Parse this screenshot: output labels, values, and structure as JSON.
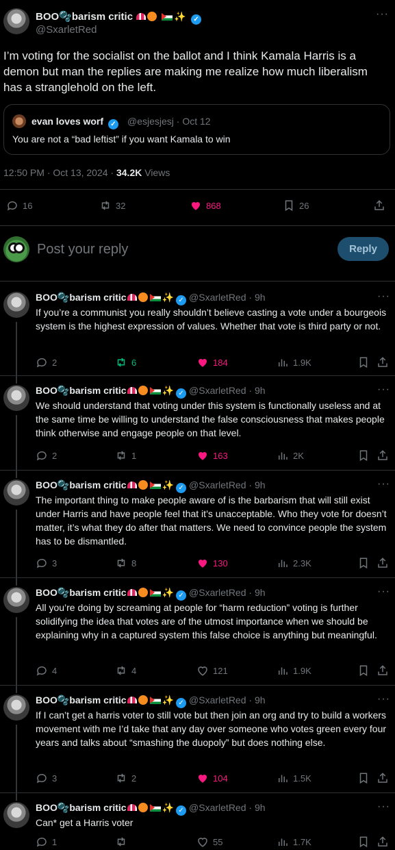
{
  "author": {
    "display_name": "BOO🫧barism critic",
    "handle": "@SxarletRed"
  },
  "main_tweet": {
    "text": "I’m voting for the socialist on the ballot and I think Kamala Harris is a demon but man the replies are making me realize how much liberalism has a stranglehold on the left.",
    "time": "12:50 PM · Oct 13, 2024 · ",
    "views": "34.2K",
    "views_label": " Views",
    "stats": {
      "replies": "16",
      "reposts": "32",
      "likes": "868",
      "bookmarks": "26"
    }
  },
  "quote": {
    "name": "evan loves worf",
    "meta": "@esjesjesj · Oct 12",
    "text": "You are not a “bad leftist” if you want Kamala to win"
  },
  "reply_box": {
    "placeholder": "Post your reply",
    "button": "Reply"
  },
  "replies": [
    {
      "age": "· 9h",
      "text": "If you’re a communist you really shouldn’t believe casting a vote under a bourgeois system is the highest expression of values. Whether that vote is third party or not.",
      "replies": "2",
      "reposts": "6",
      "likes": "184",
      "views": "1.9K"
    },
    {
      "age": "· 9h",
      "text": "We should understand that voting under this system is functionally useless and at the same time be willing to understand the false consciousness that makes people think otherwise and engage people on that level.",
      "replies": "2",
      "reposts": "1",
      "likes": "163",
      "views": "2K"
    },
    {
      "age": "· 9h",
      "text": "The important thing to make people aware of is the barbarism that will still exist under Harris and have people feel that it’s unacceptable. Who they vote for doesn’t matter, it’s what they do after that matters. We need to convince people the system has to be dismantled.",
      "replies": "3",
      "reposts": "8",
      "likes": "130",
      "views": "2.3K"
    },
    {
      "age": "· 9h",
      "text": "All you’re doing by screaming at people for “harm reduction” voting is further solidifying the idea that votes are of the utmost importance when we should be explaining why in a captured system this false choice is anything but meaningful.",
      "replies": "4",
      "reposts": "4",
      "likes": "121",
      "views": "1.9K"
    },
    {
      "age": "· 9h",
      "text": "If I can’t get a harris voter to still vote but then join an org and try to build a workers movement with me I’d take that any day over someone who votes green every four years and talks about “smashing the duopoly” but does nothing else.",
      "replies": "3",
      "reposts": "2",
      "likes": "104",
      "views": "1.5K"
    },
    {
      "age": "· 9h",
      "text": "Can* get a Harris voter",
      "replies": "1",
      "reposts": "",
      "likes": "55",
      "views": "1.7K"
    }
  ],
  "colors": {
    "like": "#f91880",
    "repost_active": "#00ba7c",
    "verified": "#1d9bf0",
    "muted": "#71767b"
  }
}
